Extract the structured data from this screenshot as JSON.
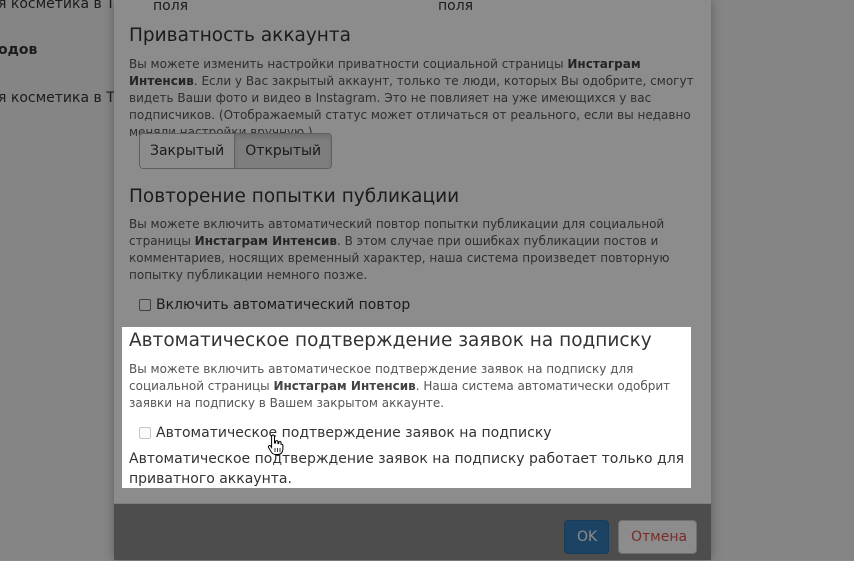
{
  "background": {
    "line1": "я косметика в Тв",
    "line2": "одов",
    "line3": "я косметика в Тв"
  },
  "modal": {
    "field_label_left": "поля",
    "field_label_right": "поля",
    "privacy": {
      "title": "Приватность аккаунта",
      "desc_pre": "Вы можете изменить настройки приватности социальной страницы ",
      "desc_bold": "Инстаграм Интенсив",
      "desc_post": ". Если у Вас закрытый аккаунт, только те люди, которых Вы одобрите, смогут видеть Ваши фото и видео в Instagram. Это не повлияет на уже имеющихся у вас подписчиков. (Отображаемый статус может отличаться от реального, если вы недавно меняли настройки вручную.)",
      "btn_closed": "Закрытый",
      "btn_open": "Открытый"
    },
    "retry": {
      "title": "Повторение попытки публикации",
      "desc_pre": "Вы можете включить автоматический повтор попытки публикации для социальной страницы ",
      "desc_bold": "Инстаграм Интенсив",
      "desc_post": ". В этом случае при ошибках публикации постов и комментариев, носящих временный характер, наша система произведет повторную попытку публикации немного позже.",
      "checkbox_label": "Включить автоматический повтор"
    },
    "auto_approve": {
      "title": "Автоматическое подтверждение заявок на подписку",
      "desc_pre": "Вы можете включить автоматическое подтверждение заявок на подписку для социальной страницы ",
      "desc_bold": "Инстаграм Интенсив",
      "desc_post": ". Наша система автоматически одобрит заявки на подписку в Вашем закрытом аккаунте.",
      "checkbox_label": "Автоматическое подтверждение заявок на подписку",
      "note": "Автоматическое подтверждение заявок на подписку работает только для приватного аккаунта."
    },
    "footer": {
      "ok_label": "OK",
      "cancel_label": "Отмена"
    }
  },
  "colors": {
    "primary": "#337ab7",
    "danger": "#d9534f"
  }
}
